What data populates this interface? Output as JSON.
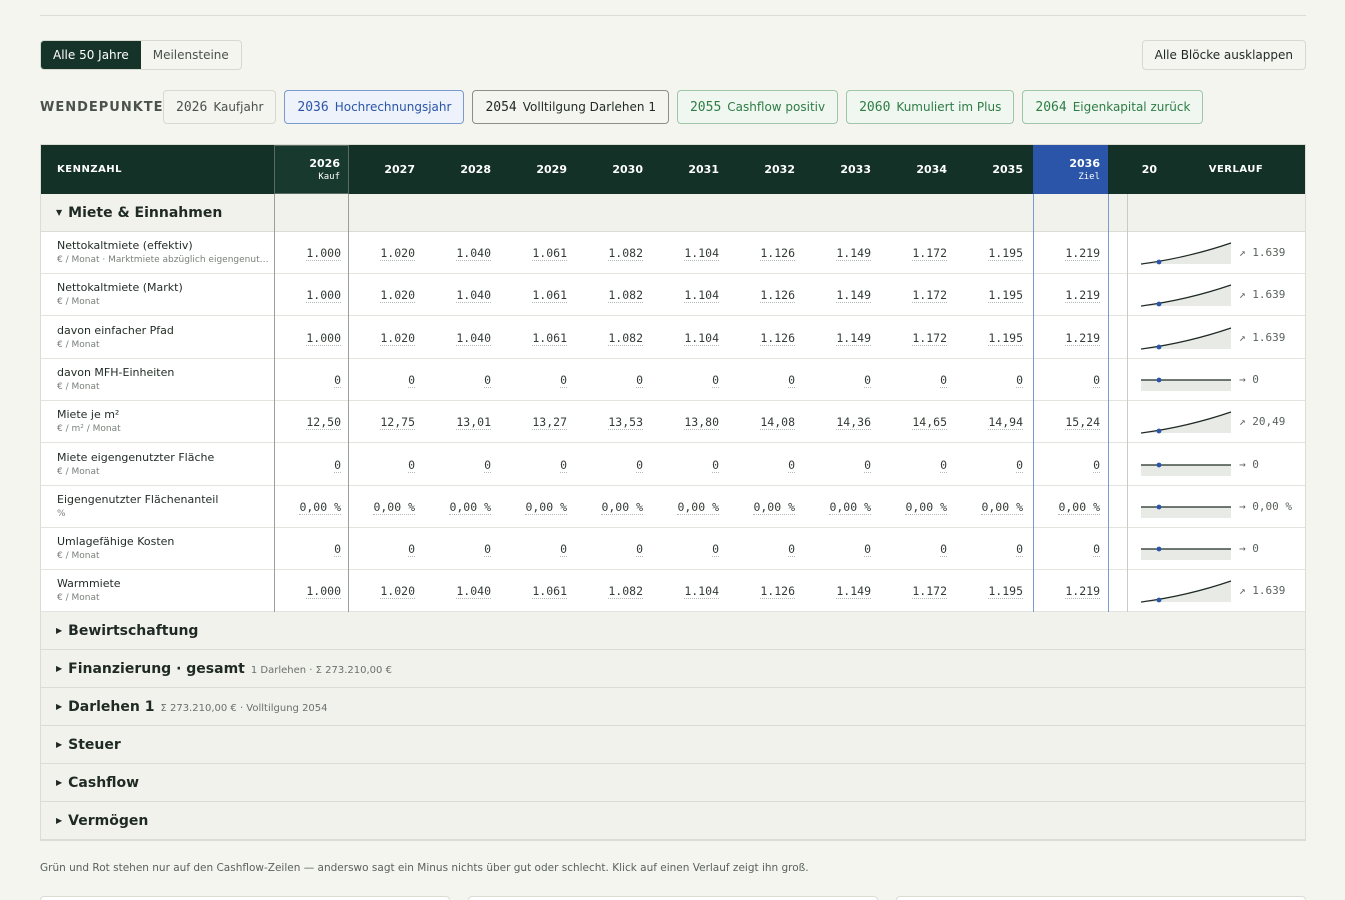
{
  "mode": {
    "all": "Alle 50 Jahre",
    "milestones": "Meilensteine"
  },
  "expand_all": "Alle Blöcke ausklappen",
  "turning_points": {
    "label": "WENDEPUNKTE",
    "chips": [
      {
        "year": "2026",
        "label": "Kaufjahr",
        "style": "neutral"
      },
      {
        "year": "2036",
        "label": "Hochrechnungsjahr",
        "style": "blue"
      },
      {
        "year": "2054",
        "label": "Volltilgung Darlehen 1",
        "style": "dark"
      },
      {
        "year": "2055",
        "label": "Cashflow positiv",
        "style": "green"
      },
      {
        "year": "2060",
        "label": "Kumuliert im Plus",
        "style": "green"
      },
      {
        "year": "2064",
        "label": "Eigenkapital zurück",
        "style": "green"
      }
    ]
  },
  "table": {
    "kennzahl_header": "KENNZAHL",
    "trend_header": "VERLAUF",
    "years": [
      {
        "year": "2026",
        "sub": "Kauf"
      },
      {
        "year": "2027",
        "sub": ""
      },
      {
        "year": "2028",
        "sub": ""
      },
      {
        "year": "2029",
        "sub": ""
      },
      {
        "year": "2030",
        "sub": ""
      },
      {
        "year": "2031",
        "sub": ""
      },
      {
        "year": "2032",
        "sub": ""
      },
      {
        "year": "2033",
        "sub": ""
      },
      {
        "year": "2034",
        "sub": ""
      },
      {
        "year": "2035",
        "sub": ""
      },
      {
        "year": "2036",
        "sub": "Ziel"
      },
      {
        "year": "20",
        "sub": ""
      }
    ],
    "open_group": "Miete & Einnahmen",
    "rows": [
      {
        "name": "Nettokaltmiete (effektiv)",
        "unit": "€ / Monat · Marktmiete abzüglich eigengenutzter Fläche",
        "values": [
          "1.000",
          "1.020",
          "1.040",
          "1.061",
          "1.082",
          "1.104",
          "1.126",
          "1.149",
          "1.172",
          "1.195",
          "1.219"
        ],
        "trend": "↗ 1.639",
        "growth": true
      },
      {
        "name": "Nettokaltmiete (Markt)",
        "unit": "€ / Monat",
        "values": [
          "1.000",
          "1.020",
          "1.040",
          "1.061",
          "1.082",
          "1.104",
          "1.126",
          "1.149",
          "1.172",
          "1.195",
          "1.219"
        ],
        "trend": "↗ 1.639",
        "growth": true
      },
      {
        "name": "davon einfacher Pfad",
        "unit": "€ / Monat",
        "values": [
          "1.000",
          "1.020",
          "1.040",
          "1.061",
          "1.082",
          "1.104",
          "1.126",
          "1.149",
          "1.172",
          "1.195",
          "1.219"
        ],
        "trend": "↗ 1.639",
        "growth": true
      },
      {
        "name": "davon MFH-Einheiten",
        "unit": "€ / Monat",
        "values": [
          "0",
          "0",
          "0",
          "0",
          "0",
          "0",
          "0",
          "0",
          "0",
          "0",
          "0"
        ],
        "trend": "→ 0",
        "growth": false
      },
      {
        "name": "Miete je m²",
        "unit": "€ / m² / Monat",
        "values": [
          "12,50",
          "12,75",
          "13,01",
          "13,27",
          "13,53",
          "13,80",
          "14,08",
          "14,36",
          "14,65",
          "14,94",
          "15,24"
        ],
        "trend": "↗ 20,49",
        "growth": true
      },
      {
        "name": "Miete eigengenutzter Fläche",
        "unit": "€ / Monat",
        "values": [
          "0",
          "0",
          "0",
          "0",
          "0",
          "0",
          "0",
          "0",
          "0",
          "0",
          "0"
        ],
        "trend": "→ 0",
        "growth": false
      },
      {
        "name": "Eigengenutzter Flächenanteil",
        "unit": "%",
        "values": [
          "0,00 %",
          "0,00 %",
          "0,00 %",
          "0,00 %",
          "0,00 %",
          "0,00 %",
          "0,00 %",
          "0,00 %",
          "0,00 %",
          "0,00 %",
          "0,00 %"
        ],
        "trend": "→ 0,00 %",
        "growth": false
      },
      {
        "name": "Umlagefähige Kosten",
        "unit": "€ / Monat",
        "values": [
          "0",
          "0",
          "0",
          "0",
          "0",
          "0",
          "0",
          "0",
          "0",
          "0",
          "0"
        ],
        "trend": "→ 0",
        "growth": false
      },
      {
        "name": "Warmmiete",
        "unit": "€ / Monat",
        "values": [
          "1.000",
          "1.020",
          "1.040",
          "1.061",
          "1.082",
          "1.104",
          "1.126",
          "1.149",
          "1.172",
          "1.195",
          "1.219"
        ],
        "trend": "↗ 1.639",
        "growth": true
      }
    ],
    "groups": [
      {
        "title": "Bewirtschaftung",
        "meta": ""
      },
      {
        "title": "Finanzierung · gesamt",
        "meta": "1 Darlehen · Σ 273.210,00 €"
      },
      {
        "title": "Darlehen 1",
        "meta": "Σ 273.210,00 € · Volltilgung 2054"
      },
      {
        "title": "Steuer",
        "meta": ""
      },
      {
        "title": "Cashflow",
        "meta": ""
      },
      {
        "title": "Vermögen",
        "meta": ""
      }
    ]
  },
  "footnote": "Grün und Rot stehen nur auf den Cashflow-Zeilen — anderswo sagt ein Minus nichts über gut oder schlecht. Klick auf einen Verlauf zeigt ihn groß.",
  "colors": {
    "header": "#133127",
    "goal": "#2a55a8",
    "accent_green": "#2e7d45"
  }
}
